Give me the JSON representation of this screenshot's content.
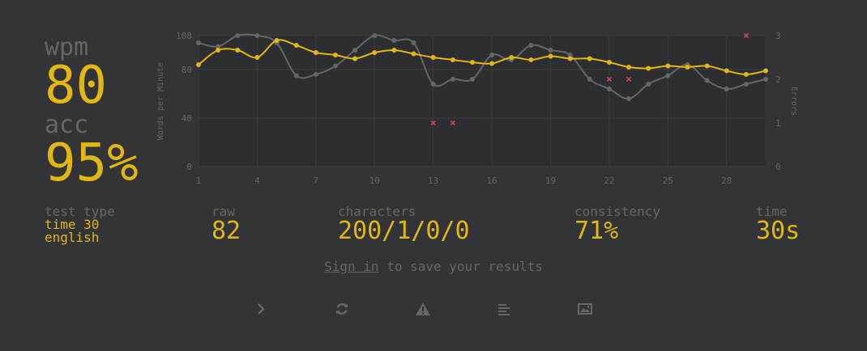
{
  "stats": {
    "wpm_label": "wpm",
    "wpm": "80",
    "acc_label": "acc",
    "acc": "95%"
  },
  "info": {
    "test_type_label": "test type",
    "test_type_time": "time 30",
    "test_type_lang": "english",
    "raw_label": "raw",
    "raw": "82",
    "characters_label": "characters",
    "characters": "200/1/0/0",
    "consistency_label": "consistency",
    "consistency": "71%",
    "time_label": "time",
    "time": "30s"
  },
  "signin": {
    "link": "Sign in",
    "rest": " to save your results"
  },
  "buttons": [
    {
      "name": "next-test-button",
      "icon": "chevron-right-icon"
    },
    {
      "name": "repeat-test-button",
      "icon": "refresh-icon"
    },
    {
      "name": "report-button",
      "icon": "warning-icon"
    },
    {
      "name": "word-history-button",
      "icon": "align-left-icon"
    },
    {
      "name": "screenshot-button",
      "icon": "image-icon"
    }
  ],
  "colors": {
    "background": "#323437",
    "plot_bg": "#2c2e31",
    "accent": "#e2b714",
    "sub": "#646669",
    "raw_line": "#646669",
    "error": "#ca4754"
  },
  "chart_data": {
    "type": "line",
    "title": "",
    "xlabel": "",
    "ylabel": "Words per Minute",
    "y2label": "Errors",
    "x": [
      1,
      2,
      3,
      4,
      5,
      6,
      7,
      8,
      9,
      10,
      11,
      12,
      13,
      14,
      15,
      16,
      17,
      18,
      19,
      20,
      21,
      22,
      23,
      24,
      25,
      26,
      27,
      28,
      29,
      30
    ],
    "xticks": [
      1,
      4,
      7,
      10,
      13,
      16,
      19,
      22,
      25,
      28
    ],
    "ylim": [
      0,
      108
    ],
    "yticks": [
      0,
      40,
      80,
      108
    ],
    "y2lim": [
      0,
      3
    ],
    "y2ticks": [
      0,
      1,
      2,
      3
    ],
    "series": [
      {
        "name": "wpm",
        "axis": "left",
        "values": [
          84,
          96,
          96,
          90,
          104,
          100,
          94,
          92,
          89,
          94,
          96,
          93,
          90,
          88,
          86,
          85,
          90,
          88,
          91,
          89,
          89,
          86,
          82,
          81,
          83,
          82,
          83,
          79,
          76,
          79
        ]
      },
      {
        "name": "raw",
        "axis": "left",
        "values": [
          102,
          99,
          108,
          108,
          102,
          75,
          76,
          83,
          96,
          108,
          104,
          102,
          68,
          72,
          72,
          92,
          88,
          100,
          96,
          92,
          72,
          64,
          56,
          68,
          75,
          84,
          71,
          64,
          68,
          72
        ]
      },
      {
        "name": "errors",
        "axis": "right",
        "type": "scatter",
        "x": [
          13,
          14,
          22,
          23,
          29
        ],
        "values": [
          1,
          1,
          2,
          2,
          3
        ]
      }
    ]
  }
}
